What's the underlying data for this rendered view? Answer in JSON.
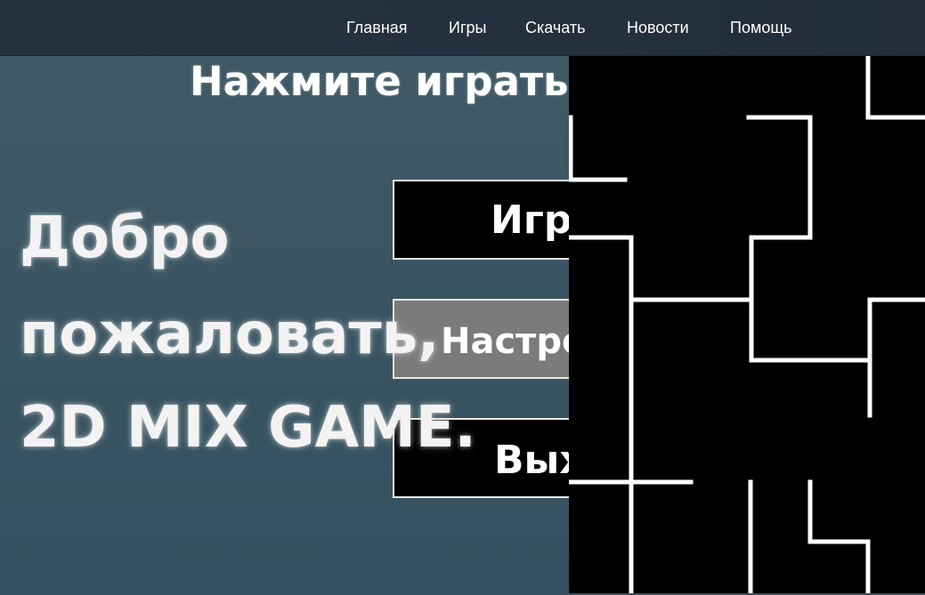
{
  "nav": {
    "items": [
      {
        "label": "Главная"
      },
      {
        "label": "Игры"
      },
      {
        "label": "Скачать"
      },
      {
        "label": "Новости"
      },
      {
        "label": "Помощь"
      }
    ]
  },
  "game": {
    "prompt": "Нажмите играть",
    "welcome_lines": [
      "Добро",
      "пожаловать,",
      "2D MIX GAME."
    ],
    "menu": {
      "play_label": "Играть",
      "settings_label": "Настройки",
      "exit_label": "Выход"
    }
  },
  "colors": {
    "navbar": "#263240",
    "background": "#3f5662",
    "button": "#000000",
    "button_highlight": "#7b7b7b",
    "maze_walls": "#ffffff",
    "maze_background": "#000000"
  }
}
